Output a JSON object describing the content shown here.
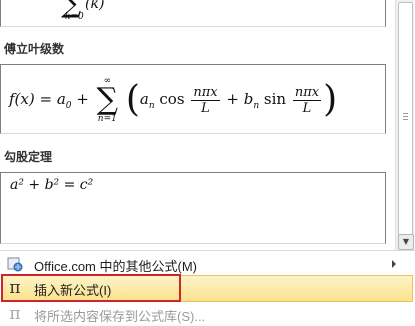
{
  "top_formula": {
    "lower": "k=0",
    "tail": "k"
  },
  "sections": [
    {
      "label": "傅立叶级数",
      "formula_lhs": "f(x) = a",
      "a0_sub": "0",
      "sum_upper": "∞",
      "sum_lower": "n=1",
      "term_a": "a",
      "term_a_sub": "n",
      "cos": "cos",
      "num": "nπx",
      "den": "L",
      "term_b": "+ b",
      "term_b_sub": "n",
      "sin": "sin"
    },
    {
      "label": "勾股定理",
      "formula": "a² + b² = c²"
    }
  ],
  "menu": {
    "items": [
      {
        "label": "Office.com 中的其他公式(M)",
        "icon": "office-globe-icon",
        "has_submenu": true
      },
      {
        "label": "插入新公式(I)",
        "icon": "pi-icon",
        "highlighted": true
      },
      {
        "label": "将所选内容保存到公式库(S)...",
        "icon": "pi-save-icon",
        "disabled": true
      }
    ]
  },
  "colors": {
    "highlight": "#fae28e",
    "highlight_border": "#d2232a"
  }
}
